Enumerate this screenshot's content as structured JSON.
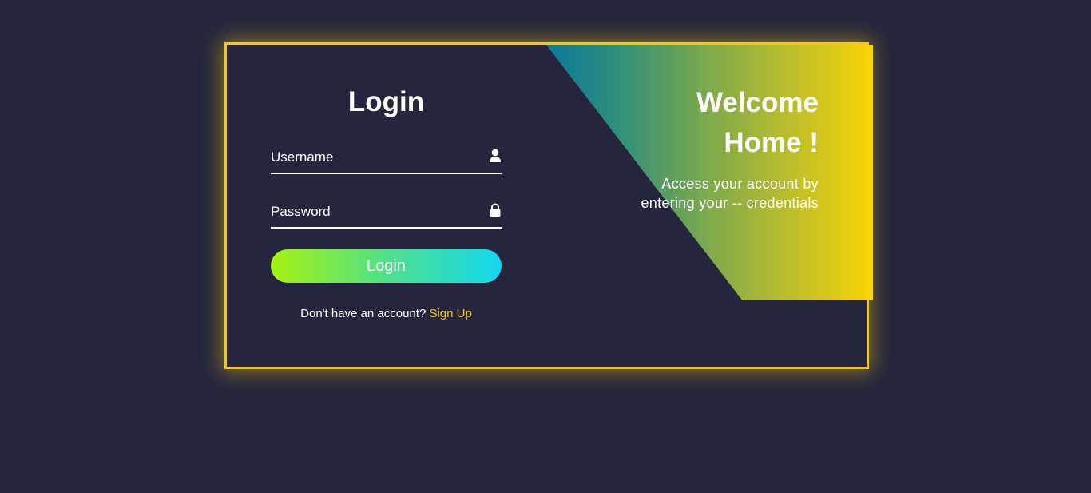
{
  "login": {
    "title": "Login",
    "username_placeholder": "Username",
    "password_placeholder": "Password",
    "button_label": "Login",
    "signup_prompt": "Don't have an account?",
    "signup_link": "Sign Up"
  },
  "welcome": {
    "line1": "Welcome",
    "line2": "Home !",
    "description": "Access your account by entering your -- credentials"
  },
  "colors": {
    "background": "#25263d",
    "border_accent": "#f6c90e",
    "link": "#f6c90e",
    "button_gradient_start": "#a6f20f",
    "button_gradient_end": "#12d8ef",
    "panel_gradient_start": "#0a7a9a",
    "panel_gradient_end": "#fad603"
  },
  "icons": {
    "username": "user-icon",
    "password": "lock-icon"
  }
}
